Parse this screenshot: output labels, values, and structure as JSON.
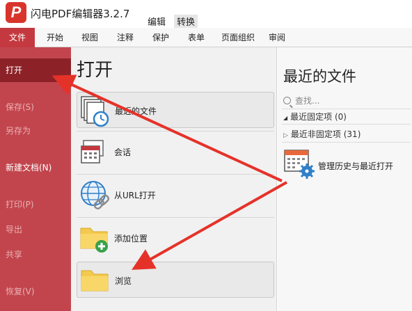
{
  "app": {
    "logo_letter": "P",
    "title": "闪电PDF编辑器3.2.7",
    "context_tabs": [
      "编辑",
      "转换"
    ]
  },
  "ribbon": {
    "tabs": [
      "文件",
      "开始",
      "视图",
      "注释",
      "保护",
      "表单",
      "页面组织",
      "审阅"
    ],
    "active": "文件"
  },
  "file_menu": {
    "items": [
      {
        "label": "打开",
        "state": "selected"
      },
      {
        "label": "保存(S)",
        "state": "disabled"
      },
      {
        "label": "另存为",
        "state": "disabled"
      },
      {
        "label": "新建文档(N)",
        "state": "enabled"
      },
      {
        "label": "打印(P)",
        "state": "disabled"
      },
      {
        "label": "导出",
        "state": "disabled"
      },
      {
        "label": "共享",
        "state": "disabled"
      },
      {
        "label": "恢复(V)",
        "state": "disabled"
      }
    ]
  },
  "open_panel": {
    "title": "打开",
    "options": [
      {
        "label": "最近的文件",
        "icon": "recent-files-clock-icon"
      },
      {
        "label": "会话",
        "icon": "session-calendar-icon"
      },
      {
        "label": "从URL打开",
        "icon": "globe-link-icon"
      },
      {
        "label": "添加位置",
        "icon": "add-folder-icon"
      },
      {
        "label": "浏览",
        "icon": "folder-icon"
      }
    ]
  },
  "recent_panel": {
    "title": "最近的文件",
    "search_placeholder": "查找...",
    "pinned_group": "最近固定项 (0)",
    "unpinned_group": "最近非固定项 (31)",
    "manage_label": "管理历史与最近打开"
  },
  "colors": {
    "brand_red": "#c4393f",
    "menu_selected": "#8c2228",
    "arrow_red": "#e53229"
  }
}
